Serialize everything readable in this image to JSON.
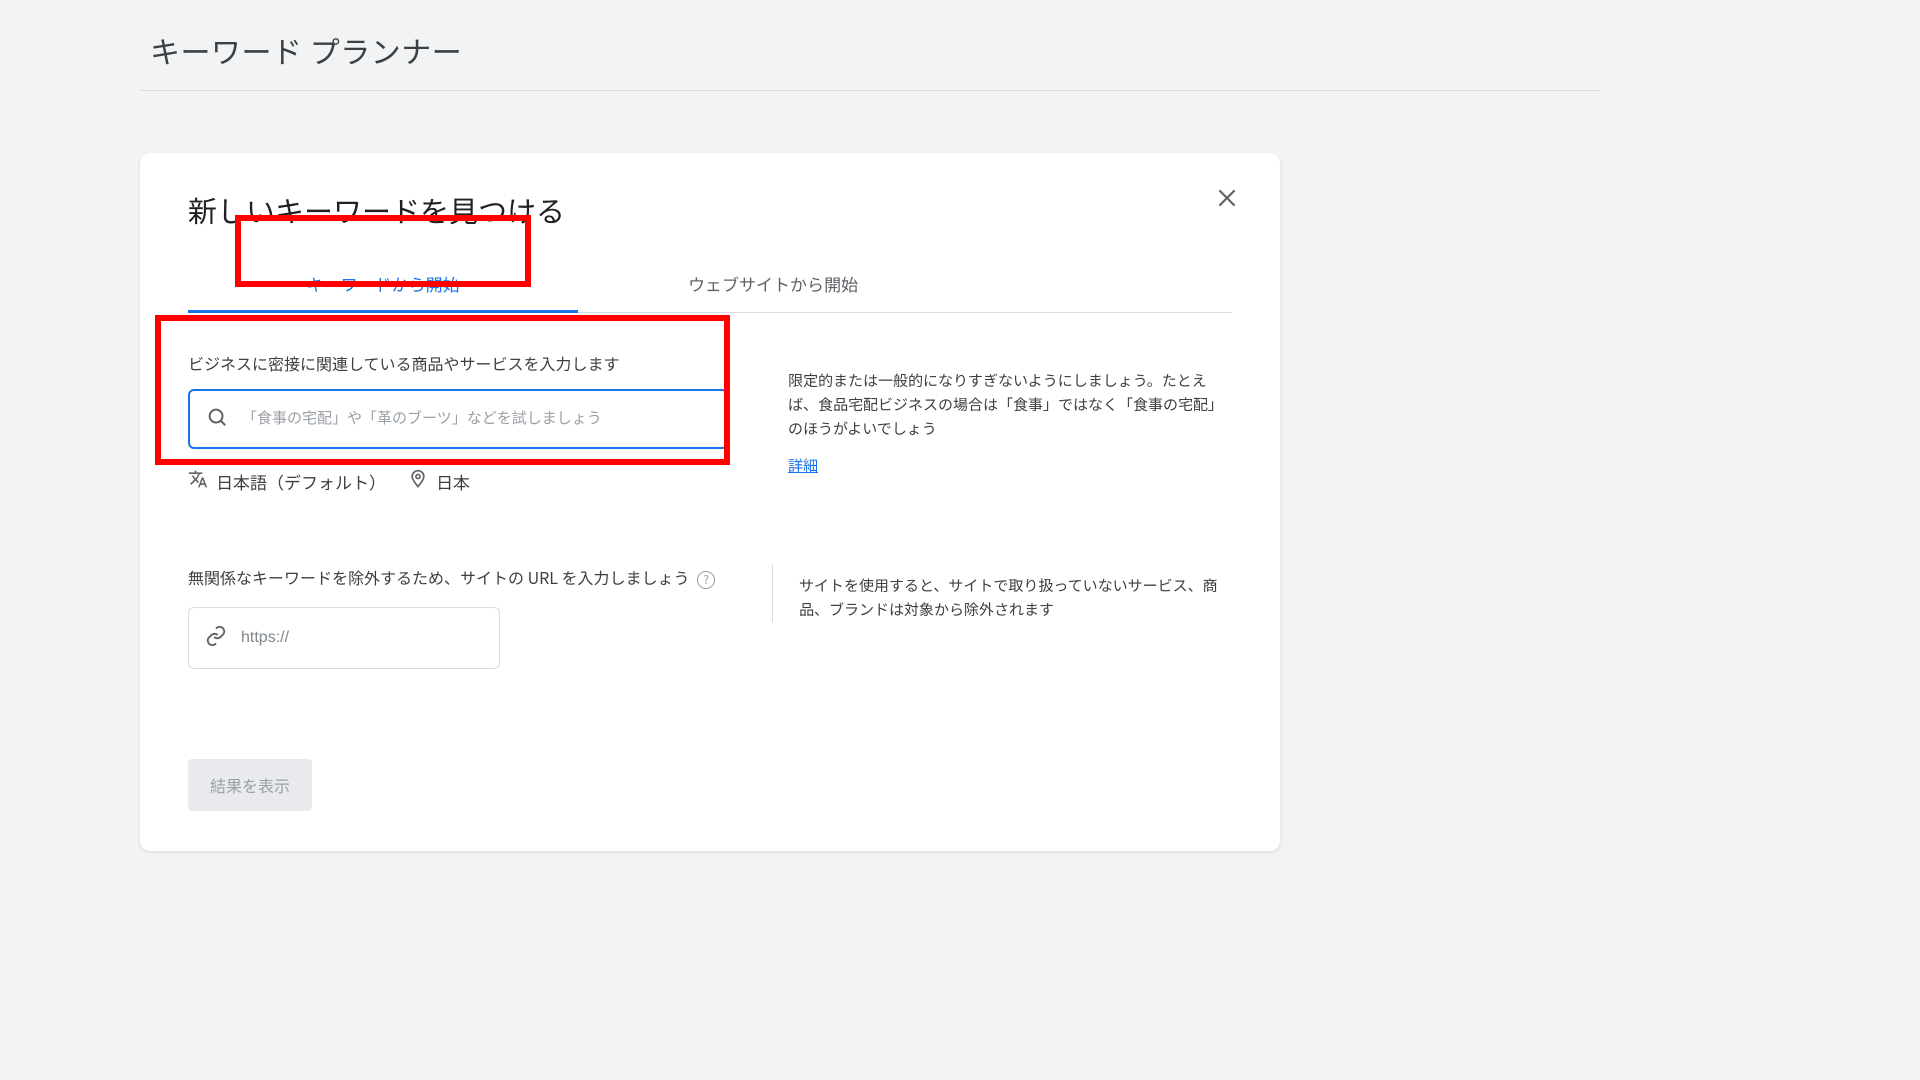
{
  "page": {
    "title": "キーワード プランナー"
  },
  "modal": {
    "title": "新しいキーワードを見つける"
  },
  "tabs": {
    "keyword": "キーワードから開始",
    "website": "ウェブサイトから開始"
  },
  "keyword_section": {
    "label": "ビジネスに密接に関連している商品やサービスを入力します",
    "placeholder": "「食事の宅配」や「革のブーツ」などを試しましょう",
    "help": "限定的または一般的になりすぎないようにしましょう。たとえば、食品宅配ビジネスの場合は「食事」ではなく「食事の宅配」のほうがよいでしょう",
    "details": "詳細"
  },
  "lang_loc": {
    "language": "日本語（デフォルト）",
    "location": "日本"
  },
  "url_section": {
    "label": "無関係なキーワードを除外するため、サイトの URL を入力しましょう",
    "placeholder": "https://",
    "help": "サイトを使用すると、サイトで取り扱っていないサービス、商品、ブランドは対象から除外されます"
  },
  "submit": {
    "label": "結果を表示"
  }
}
